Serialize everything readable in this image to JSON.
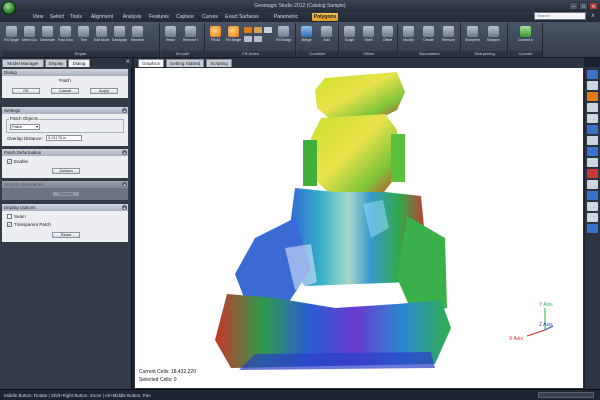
{
  "window": {
    "title": "Geomagic Studio 2012 (Catalog Sample)",
    "controls": [
      "–",
      "□",
      "✕"
    ]
  },
  "menu": {
    "tabs": [
      "View",
      "Select",
      "Tools",
      "Alignment",
      "Analysis",
      "Features",
      "Capture",
      "Curves",
      "Exact Surfaces",
      "Parametric Surfaces",
      "Polygons"
    ],
    "active_tab": "Polygons",
    "search_placeholder": "Search"
  },
  "ribbon": {
    "groups": [
      {
        "label": "Repair",
        "buttons": [
          "Fill Single",
          "Mesh Doctor",
          "Decimate",
          "Fast Smoothing",
          "Trim",
          "Edit Model",
          "Sandpaper",
          "Remesh"
        ]
      },
      {
        "label": "Smooth",
        "buttons": [
          "Relax",
          "Remove Spikes"
        ]
      },
      {
        "label": "Fill Holes",
        "buttons": [
          "Fill All",
          "Fill Single",
          "Fill Bridge"
        ]
      },
      {
        "label": "Combine",
        "buttons": [
          "Merge",
          "Add"
        ]
      },
      {
        "label": "Offset",
        "buttons": [
          "Sculpt",
          "Shell",
          "Offset"
        ]
      },
      {
        "label": "Boundaries",
        "buttons": [
          "Modify",
          "Create",
          "Remove"
        ]
      },
      {
        "label": "Sharpening",
        "buttons": [
          "Sharpening Wizard",
          "Sharpen"
        ]
      },
      {
        "label": "Convert",
        "buttons": [
          "Convert to Points"
        ]
      }
    ]
  },
  "dock": {
    "tabs": [
      "Model Manager",
      "Display",
      "Dialog"
    ],
    "active_tab": "Dialog",
    "dialog_header": "Dialog",
    "dialog_name": "Patch",
    "ok_label": "OK",
    "cancel_label": "Cancel",
    "apply_label": "Apply",
    "settings": {
      "title": "Settings",
      "group_label": "Patch Objects",
      "dropdown_value": "Patch",
      "overlap_label": "Overlap Distance:",
      "overlap_value": "0.01176 in"
    },
    "patch_deformation": {
      "title": "Patch Deformation",
      "enable_label": "Enable",
      "deform_label": "Deform"
    },
    "smooth_section": {
      "title": "Smooth Boundaries",
      "smooth_label": "Smooth"
    },
    "display_options": {
      "title": "Display Options",
      "seam_label": "Seam",
      "transparent_label": "Transparent Patch",
      "reset_label": "Reset"
    }
  },
  "viewport": {
    "tabs": [
      "Graphics",
      "Getting Started",
      "Scripting"
    ],
    "active_tab": "Graphics",
    "current_cells": "Current Cells: 18,432,220",
    "selected_cells": "Selected Cells: 0",
    "axes": {
      "y": "Y Axis",
      "x": "X Axis",
      "z": "Z Axis"
    }
  },
  "statusbar": {
    "text": "Middle Button: Rotate | Shift+Right Button: Zoom | Alt+Middle Button: Pan"
  },
  "colors": {
    "accent_tab": "#e59a1c",
    "ribbon": "#4a5568",
    "viewport_bg": "#ffffff"
  }
}
